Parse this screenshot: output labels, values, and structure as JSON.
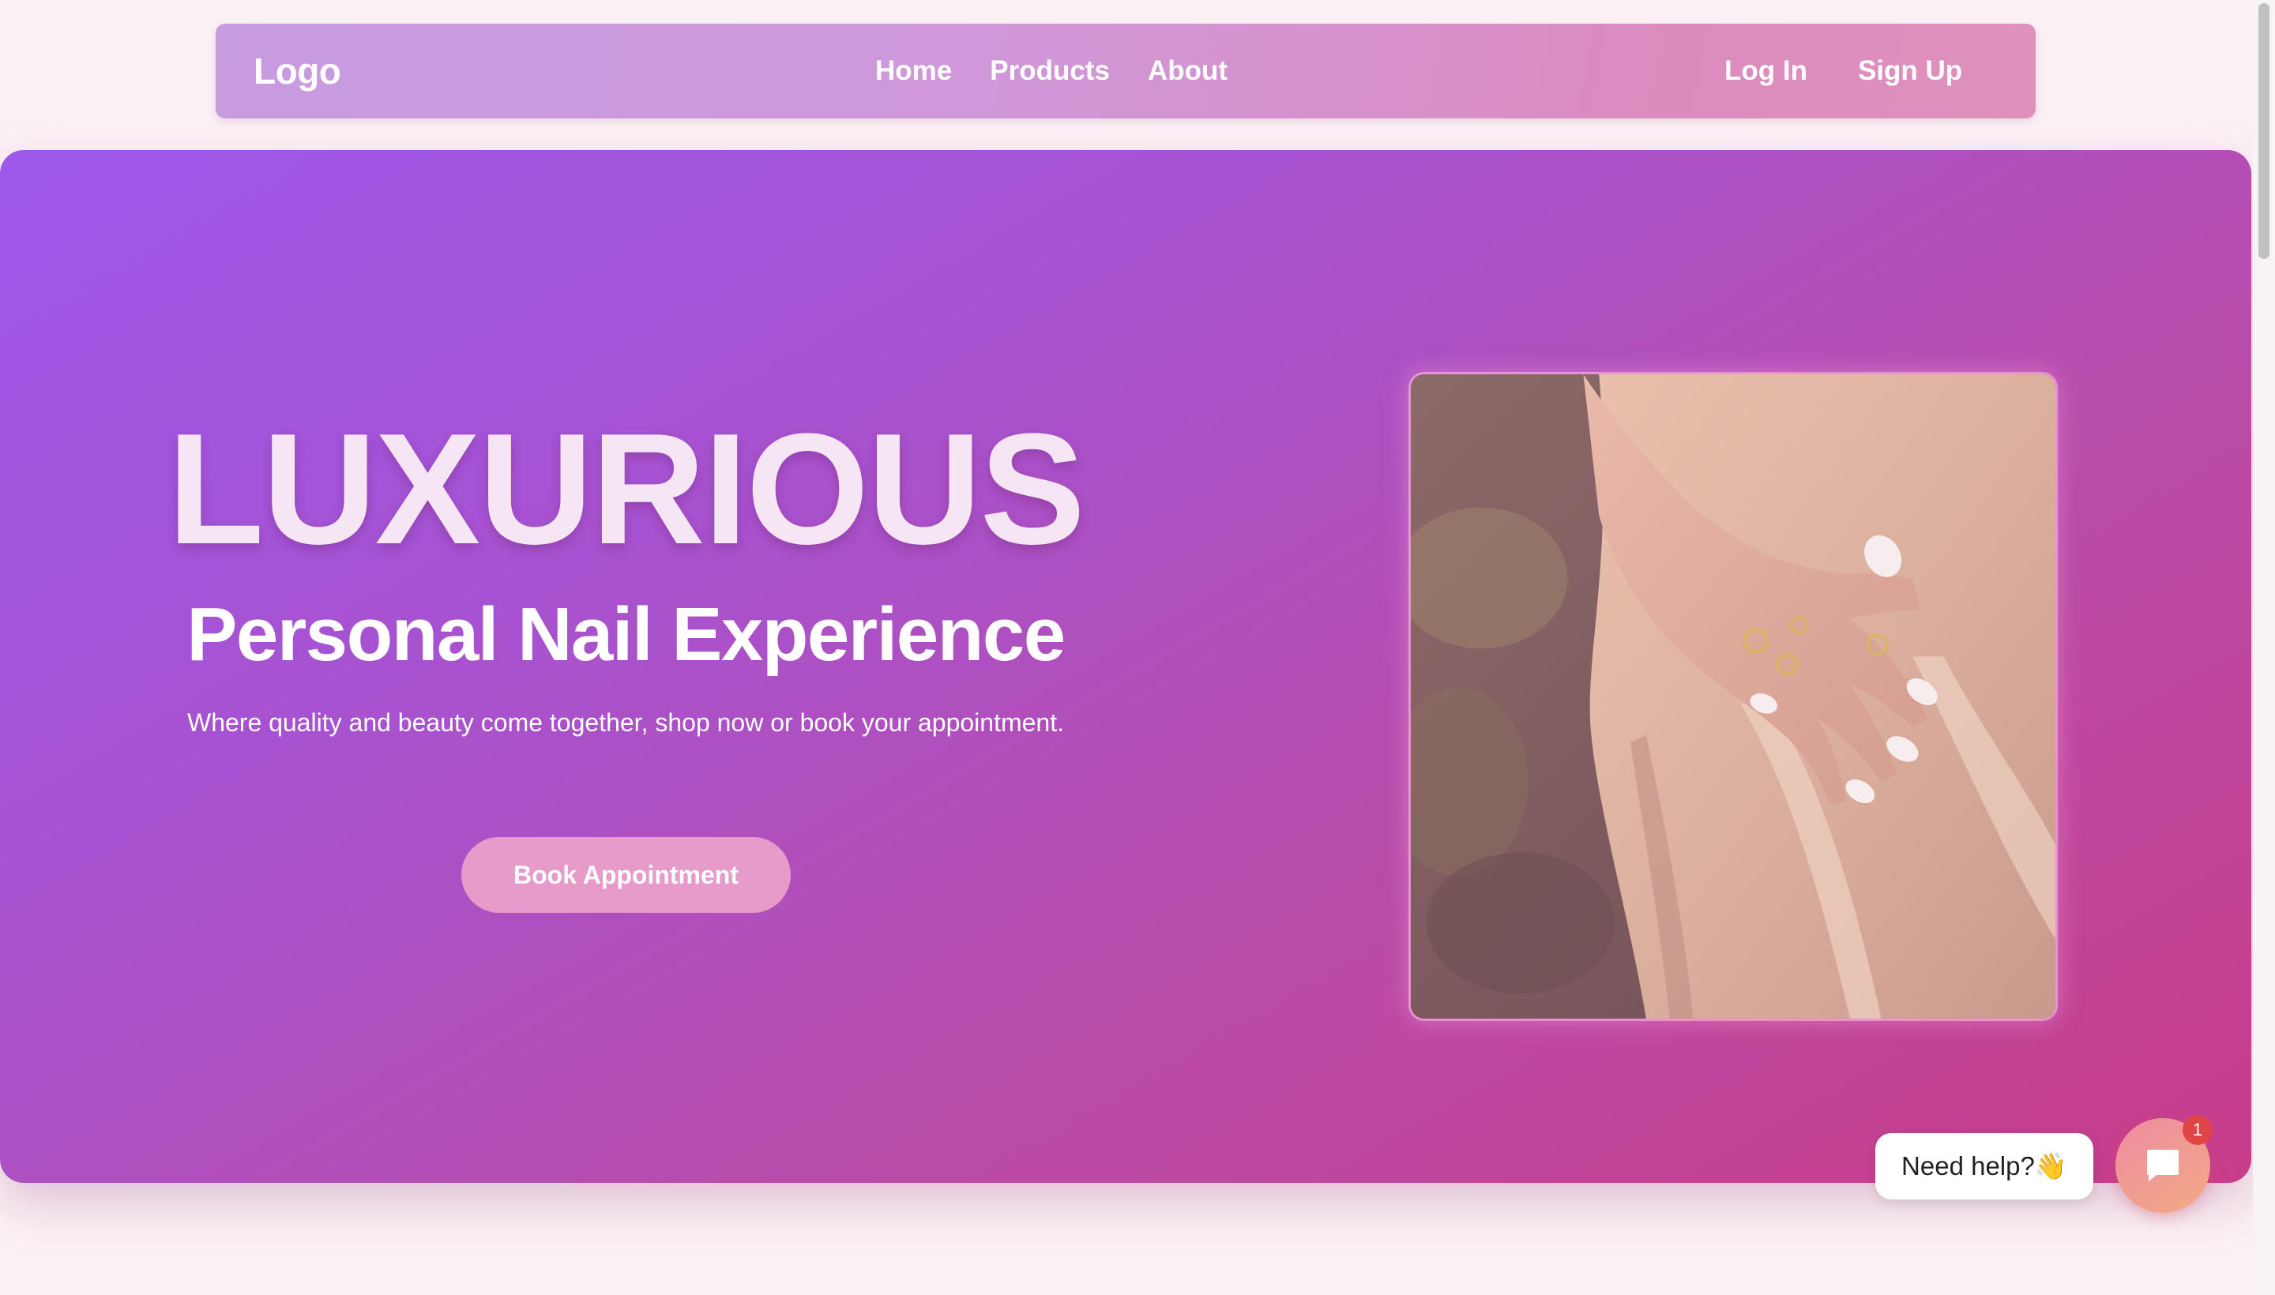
{
  "nav": {
    "logo": "Logo",
    "links": [
      "Home",
      "Products",
      "About"
    ],
    "login": "Log In",
    "signup": "Sign Up"
  },
  "hero": {
    "title": "LUXURIOUS",
    "subtitle": "Personal Nail Experience",
    "tagline": "Where quality and beauty come together, shop now or book your appointment.",
    "cta": "Book Appointment",
    "image_icon": "hand-with-manicure-photo"
  },
  "chat": {
    "prompt": "Need help?👋",
    "badge": "1",
    "icon": "chat-icon"
  },
  "colors": {
    "gradient_start": "#9d58ea",
    "gradient_end": "#c83d8a",
    "button": "#e79bcb",
    "badge": "#e04548"
  }
}
